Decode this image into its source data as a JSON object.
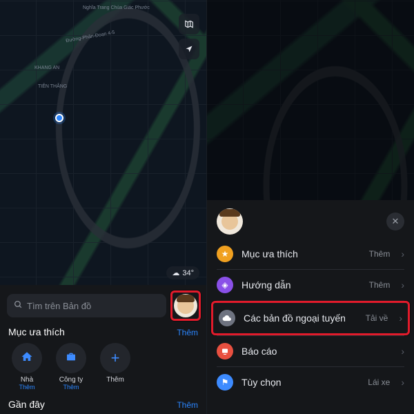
{
  "left": {
    "map_labels": {
      "khang_an": "KHANG AN",
      "tien_thang": "TIÊN THẮNG",
      "temple": "Nghĩa Trang Chùa Giác Phước",
      "road1": "Đường-Phân-Đoạn 4-5"
    },
    "weather": {
      "temp": "34°"
    },
    "search": {
      "placeholder": "Tìm trên Bản đồ"
    },
    "favorites": {
      "title": "Mục ưa thích",
      "more": "Thêm",
      "items": [
        {
          "label": "Nhà",
          "sub": "Thêm"
        },
        {
          "label": "Công ty",
          "sub": "Thêm"
        },
        {
          "label": "Thêm",
          "sub": ""
        }
      ]
    },
    "recent": {
      "title": "Gần đây",
      "more": "Thêm"
    }
  },
  "right": {
    "menu_items": [
      {
        "icon": "★",
        "label": "Mục ưa thích",
        "trail": "Thêm"
      },
      {
        "icon": "◈",
        "label": "Hướng dẫn",
        "trail": "Thêm"
      },
      {
        "icon": "☁",
        "label": "Các bản đồ ngoại tuyến",
        "trail": "Tải về"
      },
      {
        "icon": "⊟",
        "label": "Báo cáo",
        "trail": ""
      },
      {
        "icon": "⚑",
        "label": "Tùy chọn",
        "trail": "Lái xe"
      }
    ]
  }
}
